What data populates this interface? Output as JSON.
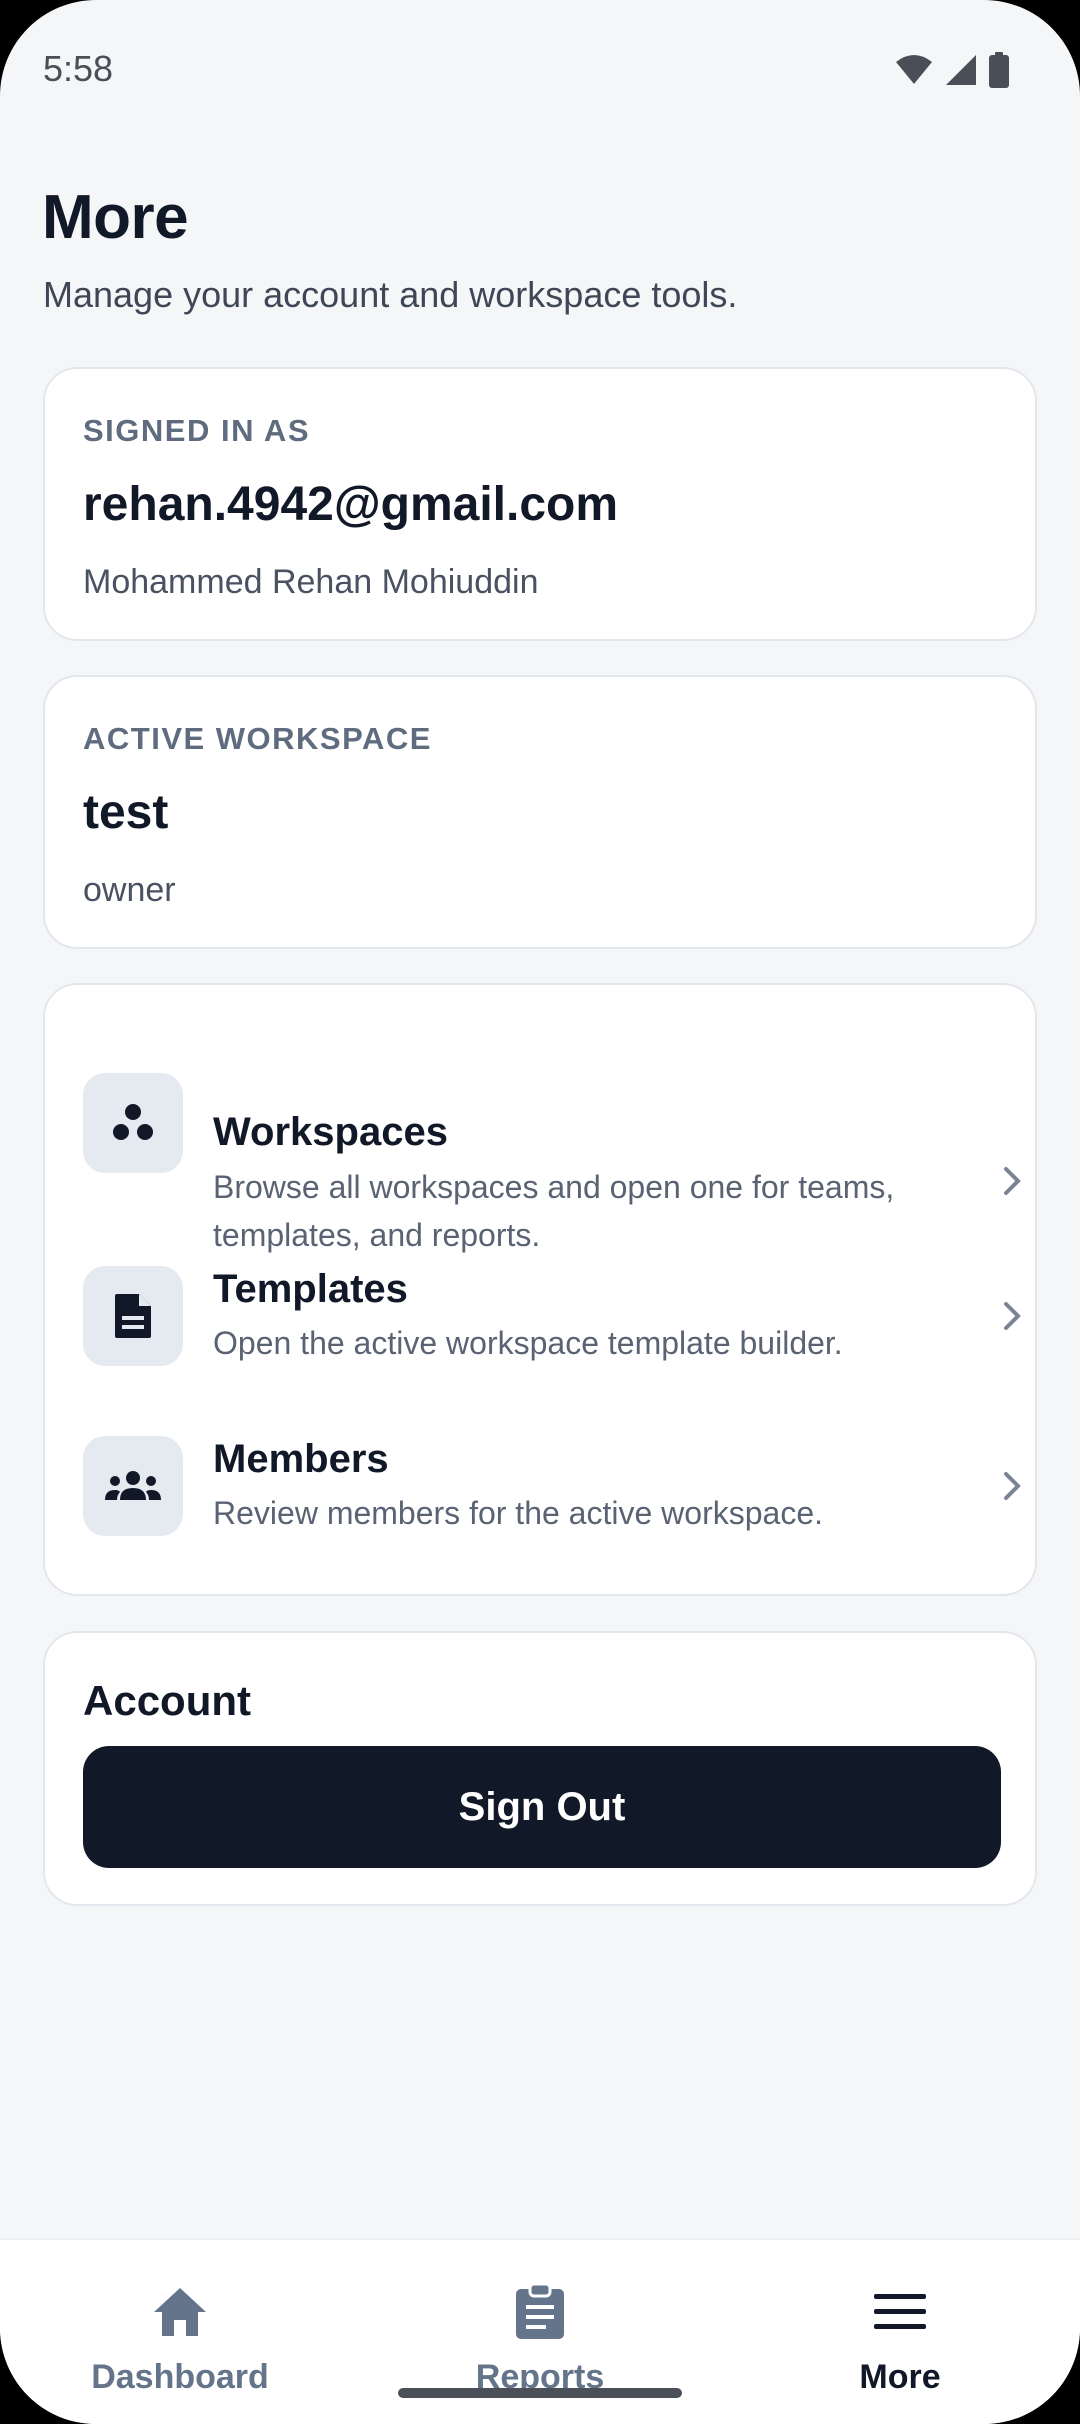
{
  "status_bar": {
    "time": "5:58",
    "icons": [
      "wifi-icon",
      "signal-icon",
      "battery-icon"
    ]
  },
  "header": {
    "title": "More",
    "subtitle": "Manage your account and workspace tools."
  },
  "signed_in": {
    "label": "SIGNED IN AS",
    "email": "rehan.4942@gmail.com",
    "name": "Mohammed Rehan Mohiuddin"
  },
  "active_workspace": {
    "label": "ACTIVE WORKSPACE",
    "name": "test",
    "role": "owner"
  },
  "links": [
    {
      "title": "Workspaces",
      "description": "Browse all workspaces and open one for teams, templates, and reports.",
      "icon": "workspaces-icon"
    },
    {
      "title": "Templates",
      "description": "Open the active workspace template builder.",
      "icon": "document-icon"
    },
    {
      "title": "Members",
      "description": "Review members for the active workspace.",
      "icon": "group-icon"
    }
  ],
  "account": {
    "title": "Account",
    "sign_out_label": "Sign Out"
  },
  "bottom_nav": {
    "items": [
      {
        "label": "Dashboard",
        "icon": "home-icon",
        "active": false
      },
      {
        "label": "Reports",
        "icon": "clipboard-icon",
        "active": false
      },
      {
        "label": "More",
        "icon": "menu-icon",
        "active": true
      }
    ]
  },
  "colors": {
    "primary_dark": "#111827",
    "background": "#f5f6f8",
    "muted": "#64748b"
  }
}
